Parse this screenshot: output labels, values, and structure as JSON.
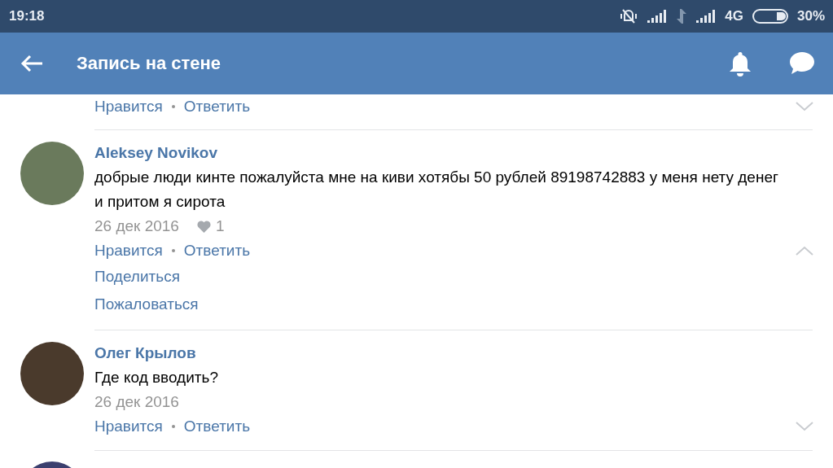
{
  "status_bar": {
    "time": "19:18",
    "network": "4G",
    "battery": "30%"
  },
  "app_bar": {
    "title": "Запись на стене"
  },
  "comments": [
    {
      "kind": "tail",
      "actions": [
        "Нравится",
        "Ответить"
      ],
      "expanded": false
    },
    {
      "kind": "full",
      "author": "Aleksey Novikov",
      "text": "добрые люди кинте пожалуйста мне на киви хотябы 50 рублей 89198742883 у меня нету денег и притом я сирота",
      "date": "26 дек 2016",
      "likes": "1",
      "actions": [
        "Нравится",
        "Ответить"
      ],
      "expanded": true,
      "more_actions": [
        "Поделиться",
        "Пожаловаться"
      ]
    },
    {
      "kind": "full",
      "author": "Олег Крылов",
      "text": "Где код вводить?",
      "date": "26 дек 2016",
      "actions": [
        "Нравится",
        "Ответить"
      ],
      "expanded": false
    },
    {
      "kind": "head"
    }
  ]
}
